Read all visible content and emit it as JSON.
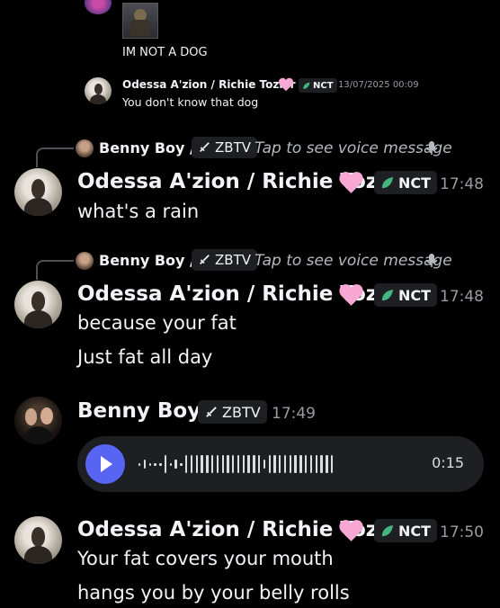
{
  "colors": {
    "background": "#000000",
    "text": "#f2f3f5",
    "muted": "#9b9ca3",
    "tag_bg": "#1e1f22",
    "accent_blurple": "#5865f2",
    "heart": "#f9a8d4",
    "leaf": "#43b581"
  },
  "top_thread": {
    "image_caption_text": "IM NOT A DOG",
    "reply": {
      "author": "Odessa A'zion / Richie Tozier",
      "tag": "NCT",
      "timestamp": "13/07/2025 00:09",
      "text": "You don't know that dog"
    }
  },
  "messages": [
    {
      "reply_to": {
        "author": "Benny Boy /p",
        "tag": "ZBTV",
        "preview": "Tap to see voice message"
      },
      "author": "Odessa A'zion / Richie Tozier",
      "tag": "NCT",
      "time": "17:48",
      "lines": [
        "what's a rain"
      ]
    },
    {
      "reply_to": {
        "author": "Benny Boy /p",
        "tag": "ZBTV",
        "preview": "Tap to see voice message"
      },
      "author": "Odessa A'zion / Richie Tozier",
      "tag": "NCT",
      "time": "17:48",
      "lines": [
        "because your fat",
        "Just fat all day"
      ]
    },
    {
      "author": "Benny Boy /p",
      "tag": "ZBTV",
      "time": "17:49",
      "voice": {
        "duration": "0:15"
      }
    },
    {
      "author": "Odessa A'zion / Richie Tozier",
      "tag": "NCT",
      "time": "17:50",
      "lines": [
        "Your fat covers your mouth",
        "hangs you by your belly rolls"
      ]
    }
  ],
  "icons": {
    "heart": "heart-icon",
    "leaf": "leaf-icon",
    "sword": "sword-icon",
    "microphone": "microphone-icon",
    "play": "play-icon"
  }
}
